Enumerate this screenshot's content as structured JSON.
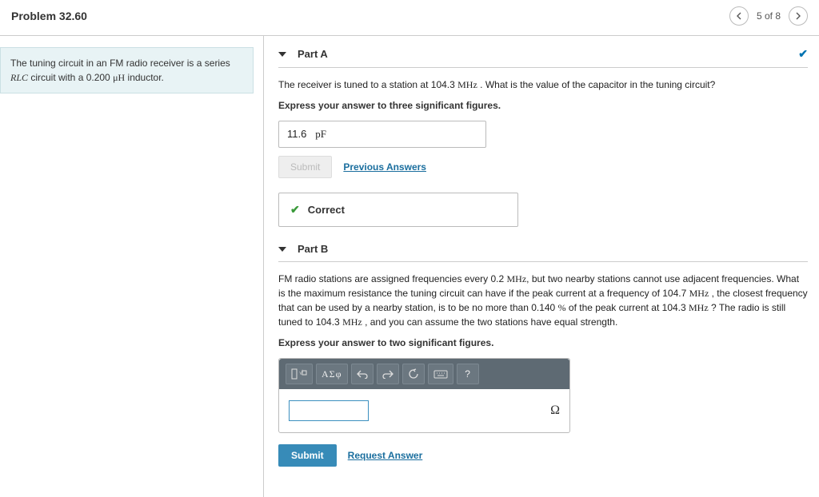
{
  "header": {
    "title": "Problem 32.60",
    "pager_text": "5 of 8"
  },
  "description": {
    "text_before": "The tuning circuit in an FM radio receiver is a series ",
    "rlc": "RLC",
    "text_mid": " circuit with a 0.200 ",
    "unit": "μH",
    "text_after": " inductor."
  },
  "partA": {
    "title": "Part A",
    "question_before": "The receiver is tuned to a station at 104.3 ",
    "mhz1": "MHz",
    "question_after": " . What is the value of the capacitor in the tuning circuit?",
    "instruction": "Express your answer to three significant figures.",
    "answer_value": "11.6",
    "answer_unit": "pF",
    "submit_label": "Submit",
    "prev_answers": "Previous Answers",
    "correct_label": "Correct"
  },
  "partB": {
    "title": "Part B",
    "q_seg1": "FM radio stations are assigned frequencies every 0.2 ",
    "mhz1": "MHz",
    "q_seg2": ", but two nearby stations cannot use adjacent frequencies. What is the maximum resistance the tuning circuit can have if the peak current at a frequency of 104.7 ",
    "mhz2": "MHz",
    "q_seg3": " , the closest frequency that can be used by a nearby station, is to be no more than 0.140 ",
    "pct": "%",
    "q_seg4": " of the peak current at 104.3 ",
    "mhz3": "MHz",
    "q_seg5": " ? The radio is still tuned to 104.3 ",
    "mhz4": "MHz",
    "q_seg6": " , and you can assume the two stations have equal strength.",
    "instruction": "Express your answer to two significant figures.",
    "greek_label": "ΑΣφ",
    "help_label": "?",
    "unit_symbol": "Ω",
    "submit_label": "Submit",
    "request_answer": "Request Answer"
  }
}
